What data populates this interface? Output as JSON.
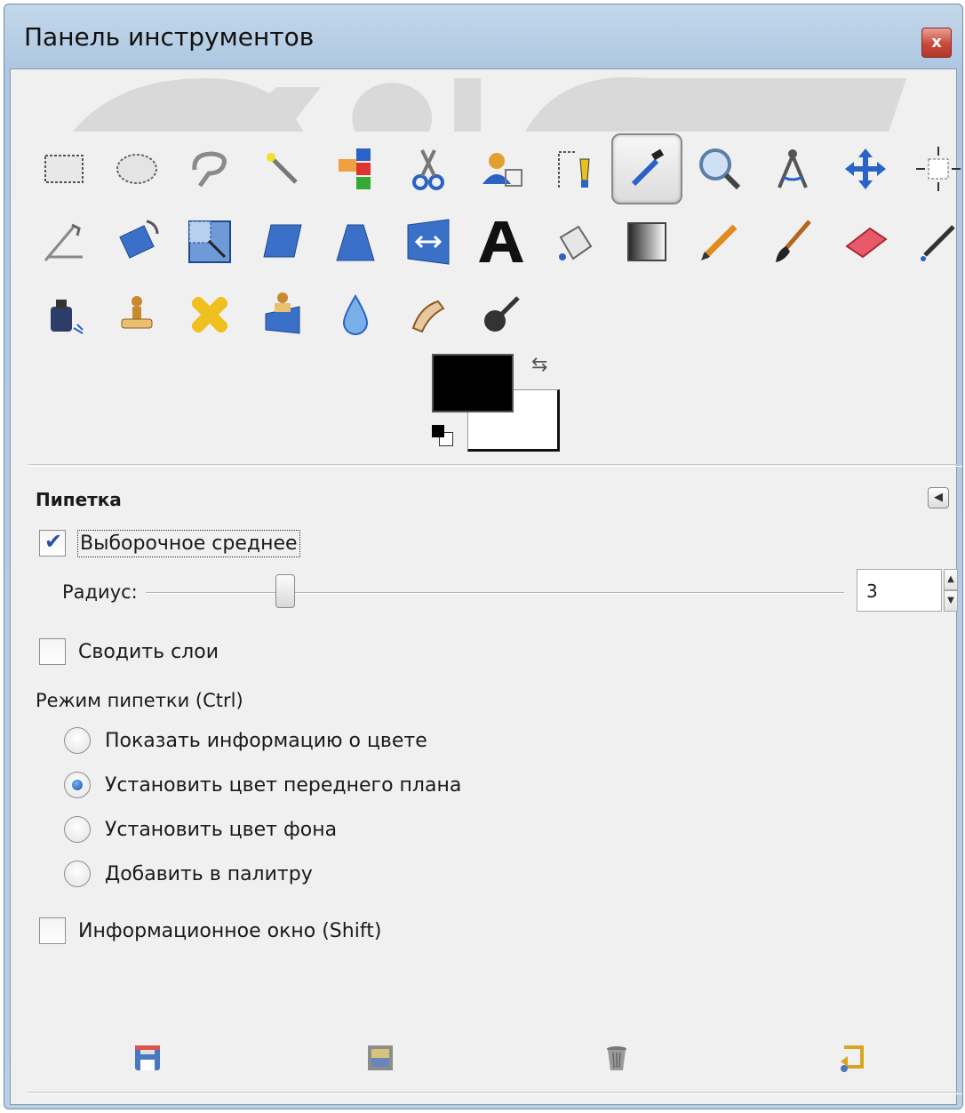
{
  "window": {
    "title": "Панель инструментов",
    "close_label": "x"
  },
  "toolbox": {
    "active_tool": "color-picker",
    "rows": [
      [
        "rect-select-icon",
        "ellipse-select-icon",
        "free-select-icon",
        "fuzzy-select-icon",
        "select-by-color-icon",
        "scissors-select-icon",
        "foreground-select-icon",
        "paths-icon",
        "color-picker-icon",
        "zoom-icon",
        "measure-icon",
        "move-icon",
        "alignment-icon"
      ],
      [
        "crop-icon",
        "rotate-icon",
        "scale-icon",
        "shear-icon",
        "perspective-icon",
        "flip-icon",
        "text-icon",
        "bucket-fill-icon",
        "blend-icon",
        "pencil-icon",
        "paintbrush-icon",
        "eraser-icon",
        "airbrush-icon"
      ],
      [
        "ink-icon",
        "clone-icon",
        "heal-icon",
        "perspective-clone-icon",
        "blur-sharpen-icon",
        "smudge-icon",
        "dodge-burn-icon"
      ]
    ]
  },
  "colors": {
    "foreground": "#000000",
    "background": "#ffffff"
  },
  "options": {
    "title": "Пипетка",
    "sample_average": {
      "label": "Выборочное среднее",
      "checked": true
    },
    "radius": {
      "label": "Радиус:",
      "value": "3",
      "fraction": 0.2
    },
    "sample_merged": {
      "label": "Сводить слои",
      "checked": false
    },
    "mode_label": "Режим пипетки  (Ctrl)",
    "modes": [
      {
        "label": "Показать информацию о цвете",
        "selected": false
      },
      {
        "label": "Установить цвет переднего плана",
        "selected": true
      },
      {
        "label": "Установить цвет фона",
        "selected": false
      },
      {
        "label": "Добавить в палитру",
        "selected": false
      }
    ],
    "info_window": {
      "label": "Информационное окно  (Shift)",
      "checked": false
    }
  },
  "bottom_buttons": [
    "save-options-icon",
    "restore-options-icon",
    "delete-options-icon",
    "reset-options-icon"
  ]
}
